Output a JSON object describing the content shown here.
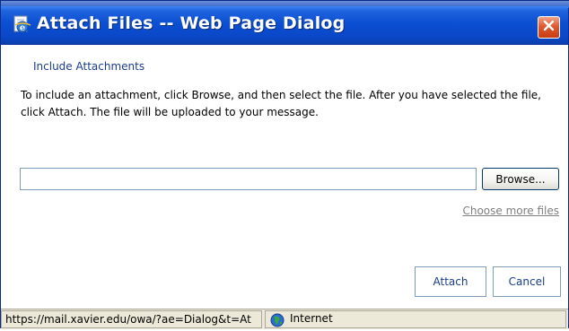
{
  "window": {
    "title": "Attach Files -- Web Page Dialog"
  },
  "dialog": {
    "heading": "Include Attachments",
    "instructions": "To include an attachment, click Browse, and then select the file. After you have selected the file, click Attach. The file will be uploaded to your message.",
    "file_input": {
      "value": "",
      "placeholder": ""
    },
    "browse_label": "Browse...",
    "more_files_label": "Choose more files",
    "attach_label": "Attach",
    "cancel_label": "Cancel"
  },
  "statusbar": {
    "url": "https://mail.xavier.edu/owa/?ae=Dialog&t=At",
    "zone": "Internet"
  },
  "icons": {
    "title": "ie-page-icon",
    "close": "close-icon",
    "zone": "globe-icon"
  },
  "colors": {
    "titlebar": "#0b4fd2",
    "close_button": "#e0582e",
    "link": "#1a3c8c",
    "muted_link": "#7f7f7f",
    "statusbar": "#ece9d8"
  }
}
